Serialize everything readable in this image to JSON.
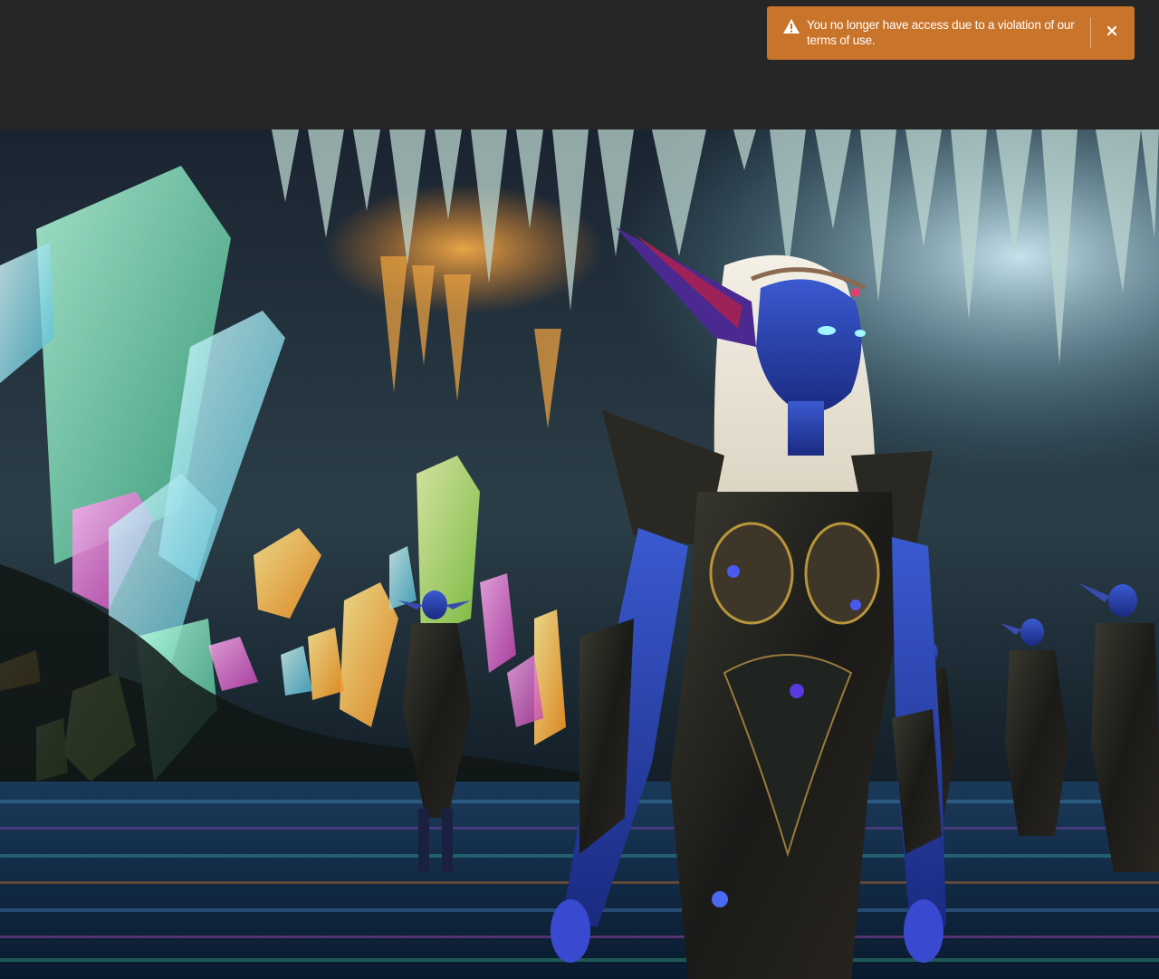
{
  "toast": {
    "icon": "warning-icon",
    "message": "You no longer have access due to a violation of our terms of use.",
    "close_icon": "close-icon",
    "background_color": "#c8742a"
  },
  "image": {
    "subject": "generated-image"
  },
  "colors": {
    "top_bar": "#262626"
  }
}
